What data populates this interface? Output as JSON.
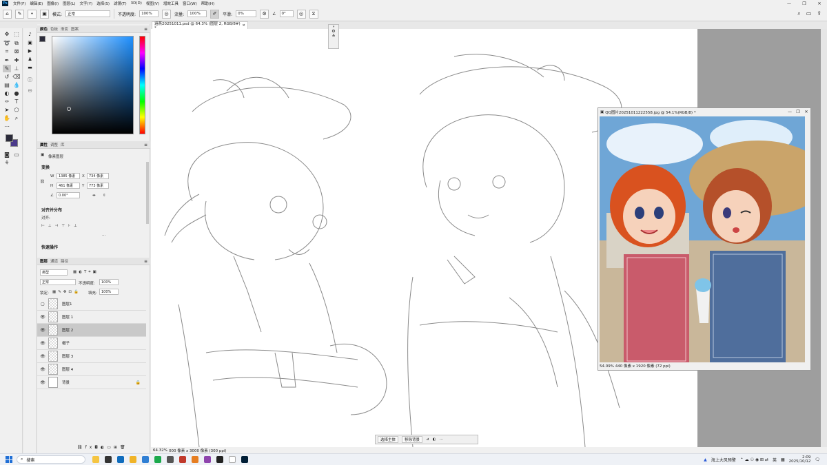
{
  "menu": {
    "app_logo": "Ps",
    "items": [
      "文件(F)",
      "编辑(E)",
      "图像(I)",
      "图层(L)",
      "文字(Y)",
      "选择(S)",
      "滤镜(T)",
      "3D(D)",
      "视图(V)",
      "增效工具",
      "窗口(W)",
      "帮助(H)"
    ]
  },
  "options": {
    "mode_label": "模式:",
    "mode_value": "正常",
    "opacity_label": "不透明度:",
    "opacity_value": "100%",
    "flow_label": "流量:",
    "flow_value": "100%",
    "smooth_label": "平滑:",
    "smooth_value": "0%",
    "angle_value": "0°"
  },
  "panels": {
    "color_tabs": [
      "颜色",
      "色板",
      "渐变",
      "图案"
    ],
    "props_tabs": [
      "属性",
      "调整",
      "库"
    ],
    "pixel_layer_label": "像素图层",
    "transform_title": "变换",
    "w_label": "W",
    "w_value": "1385 像素",
    "x_label": "X",
    "x_value": "734 像素",
    "h_label": "H",
    "h_value": "461 像素",
    "y_label": "Y",
    "y_value": "773 像素",
    "angle_value": "0.00°",
    "align_title": "对齐并分布",
    "align_label": "对齐:",
    "quick_title": "快速操作",
    "more_dots": "...",
    "layers_tabs": [
      "图层",
      "通道",
      "路径"
    ],
    "filter_kind": "类型",
    "blend_mode": "正常",
    "layer_opacity_label": "不透明度:",
    "layer_opacity_value": "100%",
    "lock_label": "锁定:",
    "fill_label": "填充:",
    "fill_value": "100%",
    "layers": [
      {
        "name": "图层1",
        "visible": false
      },
      {
        "name": "图层 1",
        "visible": true
      },
      {
        "name": "图层 2",
        "visible": true,
        "selected": true
      },
      {
        "name": "帽子",
        "visible": true
      },
      {
        "name": "图层 3",
        "visible": true
      },
      {
        "name": "图层 4",
        "visible": true
      },
      {
        "name": "背景",
        "visible": true,
        "locked": true
      }
    ]
  },
  "document": {
    "tab_title": "涵燕20251011.psd @ 64.3% (图层 2, RGB/8#) *",
    "status": "64.32%",
    "status_info": "000 像素 x 3000 像素 (300 ppi)"
  },
  "floating": {
    "select_subject": "选择主体",
    "remove_bg": "移除背景"
  },
  "reference": {
    "title": "QQ图片20251011222558.jpg @ 54.1%(RGB/8) *",
    "footer": "54.09% 440 像素 x 1920 像素 (72 ppi)"
  },
  "taskbar": {
    "search_placeholder": "搜索",
    "weather": "海上大风预警",
    "ime": "英",
    "time": "2:09",
    "date": "2025/10/12"
  }
}
